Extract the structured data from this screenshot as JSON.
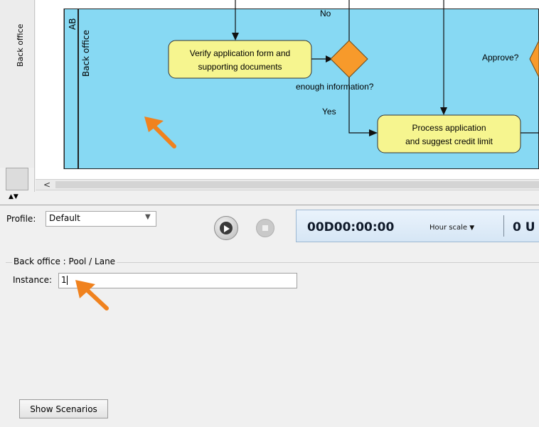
{
  "diagram": {
    "left_tab_label": "Back office",
    "pool_label_partial": "AB",
    "lane_label": "Back office",
    "task_verify": [
      "Verify application form and",
      "supporting documents"
    ],
    "task_process": [
      "Process application",
      "and suggest credit limit"
    ],
    "label_no": "No",
    "label_yes": "Yes",
    "label_enough_info": "enough information?",
    "label_approve": "Approve?",
    "colors": {
      "pool_fill": "#87d9f3",
      "task_fill": "#f6f58f",
      "gateway_fill": "#f79a2b",
      "arrow_annotation": "#f0821e"
    }
  },
  "scrollbar": {
    "left_arrow": "<"
  },
  "simulation": {
    "profile_label": "Profile:",
    "profile_value": "Default",
    "run_icon": "play-circle-icon",
    "stop_icon": "stop-icon",
    "timer": "00D00:00:00",
    "scale_label": "Hour scale",
    "count_partial": "0 U"
  },
  "properties": {
    "group_title": "Back office : Pool / Lane",
    "instance_label": "Instance:",
    "instance_value": "1"
  },
  "show_scenarios_label": "Show Scenarios"
}
